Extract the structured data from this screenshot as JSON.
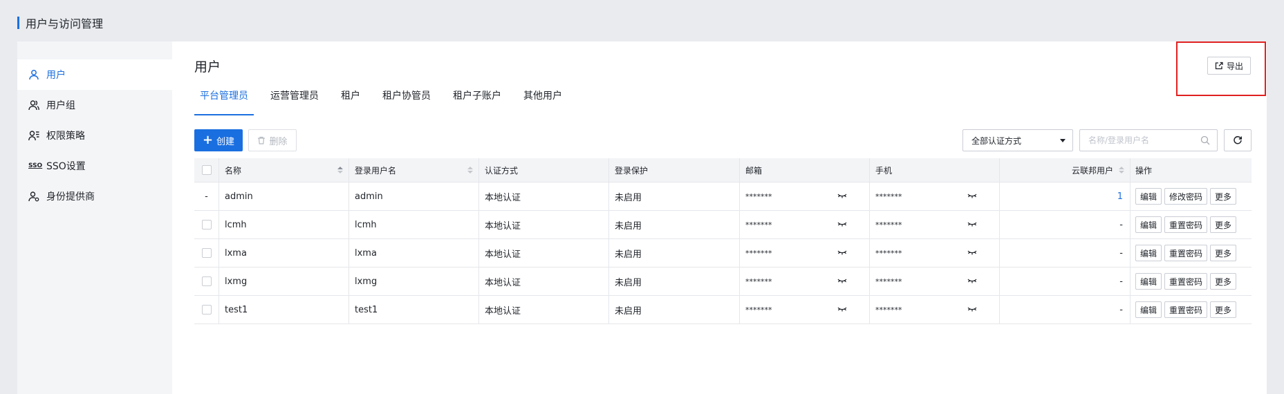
{
  "page": {
    "title": "用户与访问管理"
  },
  "sidebar": {
    "items": [
      {
        "label": "用户",
        "icon": "user-icon",
        "active": true
      },
      {
        "label": "用户组",
        "icon": "user-group-icon",
        "active": false
      },
      {
        "label": "权限策略",
        "icon": "policy-icon",
        "active": false
      },
      {
        "label": "SSO设置",
        "icon": "sso-icon",
        "icon_text": "SSO",
        "active": false
      },
      {
        "label": "身份提供商",
        "icon": "identity-provider-icon",
        "active": false
      }
    ]
  },
  "main": {
    "title": "用户",
    "export_label": "导出",
    "tabs": [
      {
        "label": "平台管理员",
        "active": true
      },
      {
        "label": "运营管理员",
        "active": false
      },
      {
        "label": "租户",
        "active": false
      },
      {
        "label": "租户协管员",
        "active": false
      },
      {
        "label": "租户子账户",
        "active": false
      },
      {
        "label": "其他用户",
        "active": false
      }
    ]
  },
  "toolbar": {
    "create_label": "创建",
    "delete_label": "删除",
    "auth_select_value": "全部认证方式",
    "search_placeholder": "名称/登录用户名"
  },
  "table": {
    "columns": {
      "name": "名称",
      "login": "登录用户名",
      "auth": "认证方式",
      "protection": "登录保护",
      "email": "邮箱",
      "phone": "手机",
      "federated": "云联邦用户",
      "ops": "操作"
    },
    "rows": [
      {
        "check": "-",
        "name": "admin",
        "login": "admin",
        "auth": "本地认证",
        "protection": "未启用",
        "email": "*******",
        "phone": "*******",
        "federated": "1",
        "op1": "编辑",
        "op2": "修改密码",
        "op3": "更多"
      },
      {
        "check": "",
        "name": "lcmh",
        "login": "lcmh",
        "auth": "本地认证",
        "protection": "未启用",
        "email": "*******",
        "phone": "*******",
        "federated": "-",
        "op1": "编辑",
        "op2": "重置密码",
        "op3": "更多"
      },
      {
        "check": "",
        "name": "lxma",
        "login": "lxma",
        "auth": "本地认证",
        "protection": "未启用",
        "email": "*******",
        "phone": "*******",
        "federated": "-",
        "op1": "编辑",
        "op2": "重置密码",
        "op3": "更多"
      },
      {
        "check": "",
        "name": "lxmg",
        "login": "lxmg",
        "auth": "本地认证",
        "protection": "未启用",
        "email": "*******",
        "phone": "*******",
        "federated": "-",
        "op1": "编辑",
        "op2": "重置密码",
        "op3": "更多"
      },
      {
        "check": "",
        "name": "test1",
        "login": "test1",
        "auth": "本地认证",
        "protection": "未启用",
        "email": "*******",
        "phone": "*******",
        "federated": "-",
        "op1": "编辑",
        "op2": "重置密码",
        "op3": "更多"
      }
    ]
  },
  "colors": {
    "accent": "#1a6fe0",
    "highlight": "#e02020",
    "background": "#e9ebef"
  }
}
